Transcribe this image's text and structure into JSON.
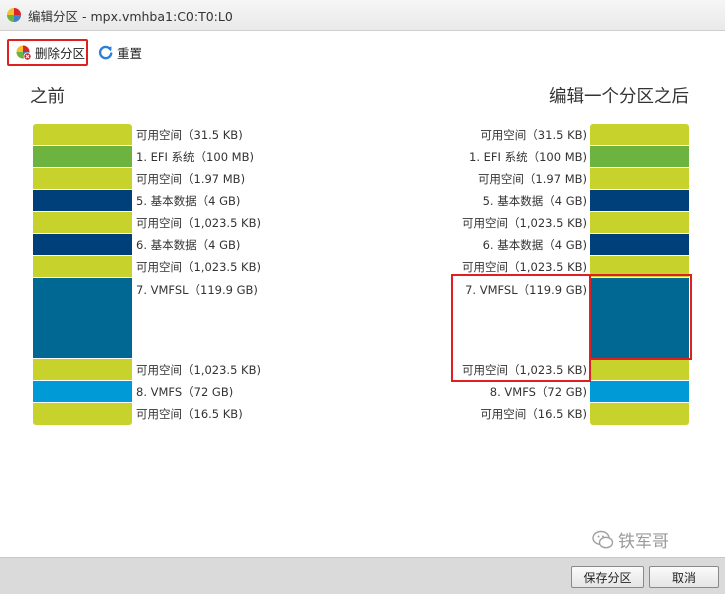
{
  "window": {
    "title": "编辑分区 - mpx.vmhba1:C0:T0:L0"
  },
  "toolbar": {
    "delete_label": "删除分区",
    "reset_label": "重置"
  },
  "headings": {
    "before": "之前",
    "after": "编辑一个分区之后"
  },
  "partitions_before": [
    {
      "type": "free",
      "label": "可用空间（31.5 KB)"
    },
    {
      "type": "efi",
      "label": "1. EFI 系统（100 MB)"
    },
    {
      "type": "free",
      "label": "可用空间（1.97 MB)"
    },
    {
      "type": "basic",
      "label": "5. 基本数据（4 GB)"
    },
    {
      "type": "free",
      "label": "可用空间（1,023.5 KB)"
    },
    {
      "type": "basic",
      "label": "6. 基本数据（4 GB)"
    },
    {
      "type": "free",
      "label": "可用空间（1,023.5 KB)"
    },
    {
      "type": "vmfsl",
      "label": "7. VMFSL（119.9 GB)"
    },
    {
      "type": "free",
      "label": "可用空间（1,023.5 KB)"
    },
    {
      "type": "vmfs",
      "label": "8. VMFS（72 GB)"
    },
    {
      "type": "free",
      "label": "可用空间（16.5 KB)"
    }
  ],
  "partitions_after": [
    {
      "type": "free",
      "label": "可用空间（31.5 KB)"
    },
    {
      "type": "efi",
      "label": "1. EFI 系统（100 MB)"
    },
    {
      "type": "free",
      "label": "可用空间（1.97 MB)"
    },
    {
      "type": "basic",
      "label": "5. 基本数据（4 GB)"
    },
    {
      "type": "free",
      "label": "可用空间（1,023.5 KB)"
    },
    {
      "type": "basic",
      "label": "6. 基本数据（4 GB)"
    },
    {
      "type": "free",
      "label": "可用空间（1,023.5 KB)"
    },
    {
      "type": "vmfsl",
      "label": "7. VMFSL（119.9 GB)"
    },
    {
      "type": "free",
      "label": "可用空间（1,023.5 KB)"
    },
    {
      "type": "vmfs",
      "label": "8. VMFS（72 GB)"
    },
    {
      "type": "free",
      "label": "可用空间（16.5 KB)"
    }
  ],
  "footer": {
    "save_label": "保存分区",
    "cancel_label": "取消"
  },
  "watermark": {
    "text": "铁军哥"
  }
}
